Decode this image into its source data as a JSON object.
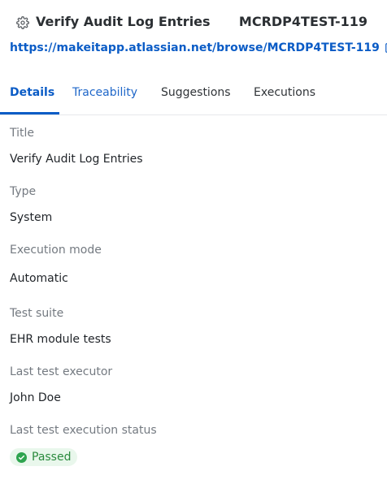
{
  "header": {
    "title": "Verify Audit Log Entries",
    "key": "MCRDP4TEST-119",
    "url": "https://makeitapp.atlassian.net/browse/MCRDP4TEST-119"
  },
  "tabs": [
    {
      "label": "Details",
      "active": true
    },
    {
      "label": "Traceability",
      "active": false
    },
    {
      "label": "Suggestions",
      "active": false
    },
    {
      "label": "Executions",
      "active": false
    }
  ],
  "fields": {
    "title": {
      "label": "Title",
      "value": "Verify Audit Log Entries"
    },
    "type": {
      "label": "Type",
      "value": "System"
    },
    "execution_mode": {
      "label": "Execution mode",
      "value": "Automatic"
    },
    "test_suite": {
      "label": "Test suite",
      "value": "EHR module tests"
    },
    "last_executor": {
      "label": "Last test executor",
      "value": "John Doe"
    },
    "last_status": {
      "label": "Last test execution status",
      "value": "Passed"
    }
  },
  "colors": {
    "accent": "#0b5cc6",
    "success_bg": "#e9f7ec",
    "success_text": "#2a8a3d"
  },
  "icons": {
    "settings": "gear-icon",
    "external": "external-link-icon",
    "status": "check-circle-icon"
  }
}
